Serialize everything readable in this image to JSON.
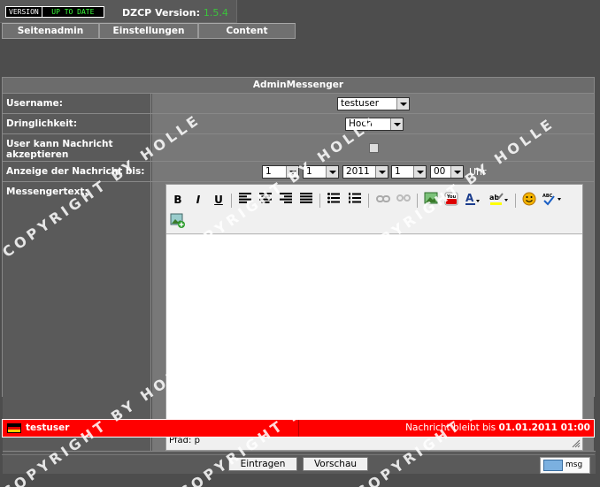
{
  "topbar": {
    "badge_left": "VERSION",
    "badge_right": "UP TO DATE",
    "dzcp_label": "DZCP Version:",
    "dzcp_version": "1.5.4"
  },
  "nav": [
    {
      "label": "Seitenadmin"
    },
    {
      "label": "Einstellungen"
    },
    {
      "label": "Content"
    }
  ],
  "panel": {
    "title": "AdminMessenger",
    "rows": {
      "username_label": "Username:",
      "username_value": "testuser",
      "dringlichkeit_label": "Dringlichkeit:",
      "dringlichkeit_value": "Hoch",
      "accept_label": "User kann Nachricht akzeptieren",
      "anzeige_label": "Anzeige der Nachricht bis:",
      "day": "1",
      "month": "1",
      "year": "2011",
      "hour": "1",
      "minute": "00",
      "uhr": "Uhr",
      "messenger_label": "Messengertext:"
    },
    "editor": {
      "path_label": "Pfad: p",
      "buttons": [
        "B",
        "I",
        "U"
      ]
    },
    "buttons": {
      "eintragen": "Eintragen",
      "vorschau": "Vorschau"
    }
  },
  "messenger_bar": {
    "username": "testuser",
    "info_text": "Nachricht bleibt bis",
    "info_date": "01.01.2011 01:00"
  },
  "msg_button_label": "msg",
  "watermark": "COPYRIGHT BY HOLLE",
  "colors": {
    "background": "#4d4d4d",
    "row_value": "#787878",
    "alert_bar": "#ff0000",
    "version_green": "#3bc43b"
  }
}
